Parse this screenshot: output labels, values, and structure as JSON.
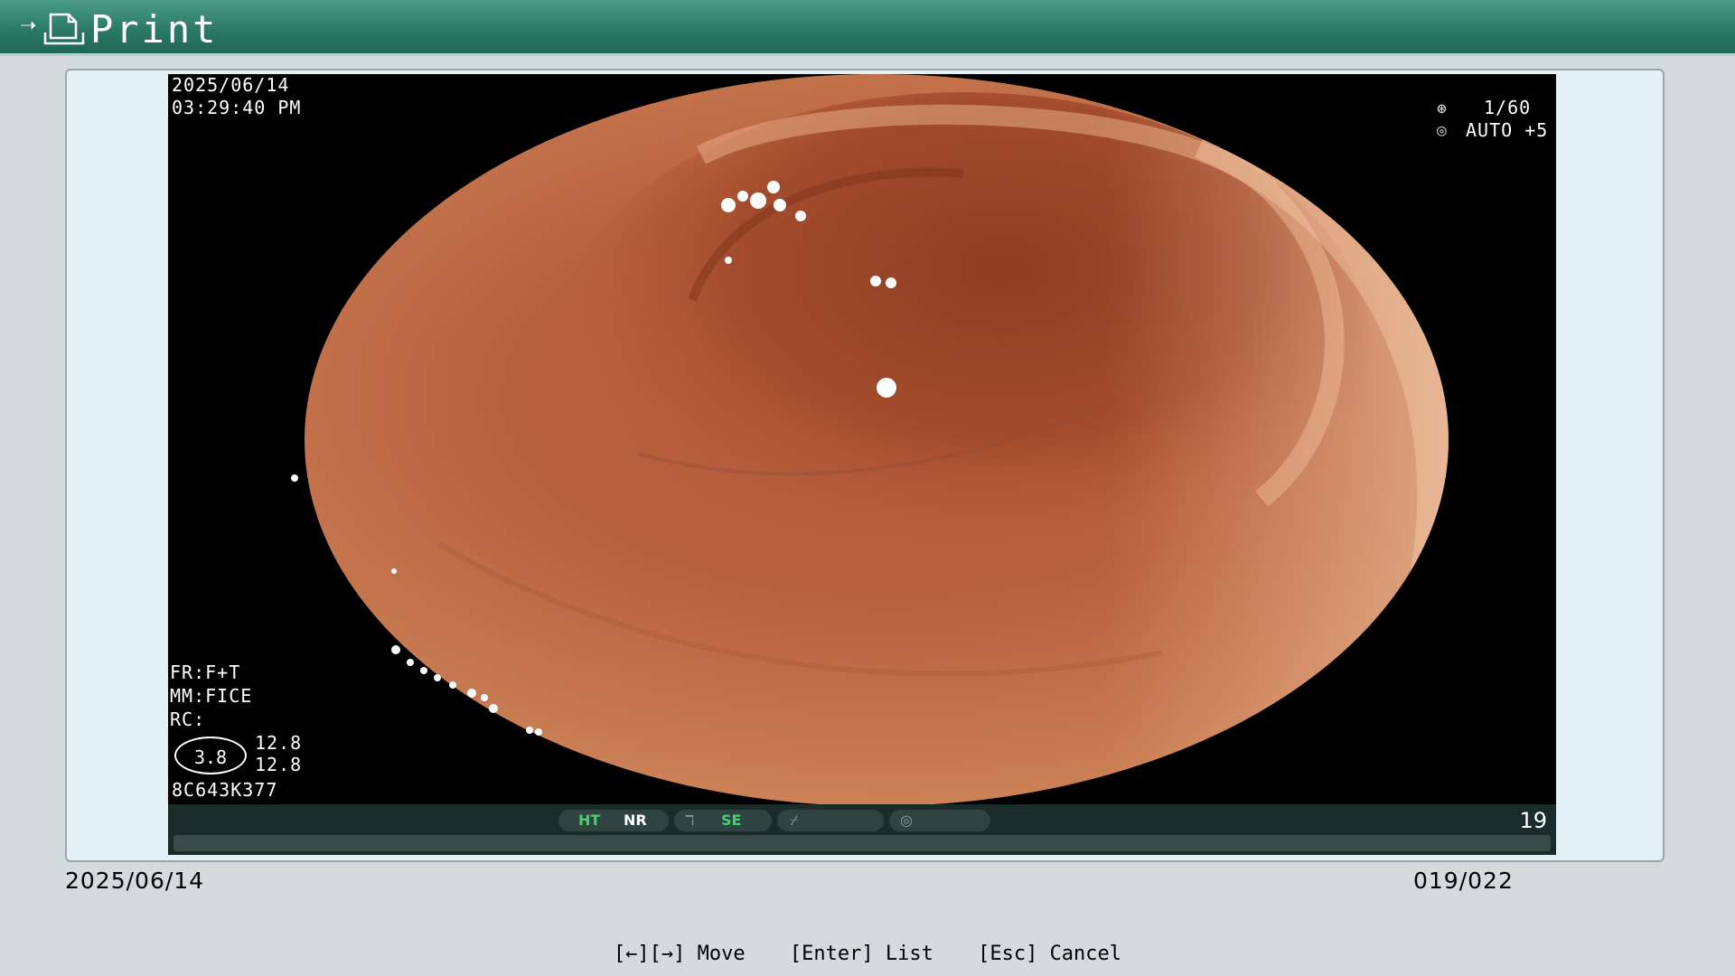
{
  "titlebar": {
    "title": "Print",
    "arrow_icon": "arrow-right-icon",
    "doc_icon": "document-icon",
    "color": "#2c7a64"
  },
  "overlay": {
    "date": "2025/06/14",
    "time": "03:29:40  PM",
    "shutter": "1/60",
    "auto": "AUTO +5",
    "fr": "FR:F+T",
    "mm": "MM:FICE",
    "rc": "RC:",
    "ratio": "3.8",
    "value1": "12.8",
    "value2": "12.8",
    "serial": "8C643K377"
  },
  "status": {
    "ht": "HT",
    "nr": "NR",
    "se": "SE",
    "image_number": "19",
    "ht_color": "#44d36a",
    "se_color": "#44d36a"
  },
  "footer": {
    "date": "2025/06/14",
    "count": "019/022"
  },
  "hints": {
    "move": "[←][→] Move",
    "list": "[Enter] List",
    "cancel": "[Esc] Cancel"
  }
}
